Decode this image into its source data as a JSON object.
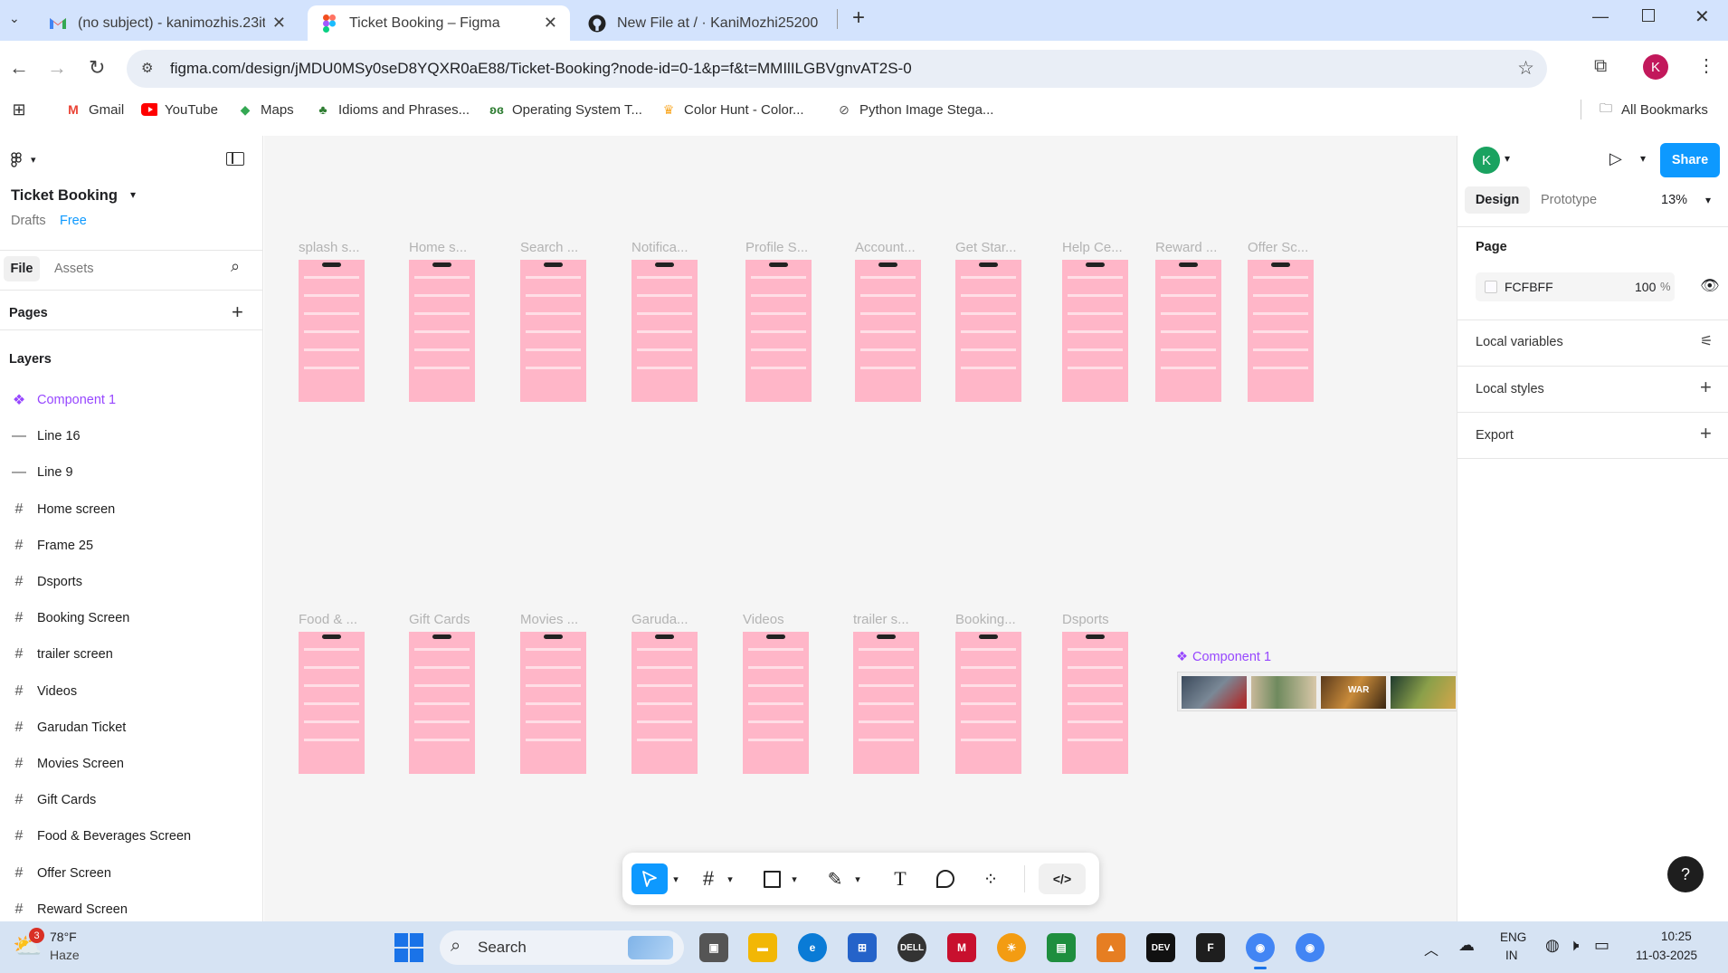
{
  "browser": {
    "tabs": [
      {
        "title": "(no subject) - kanimozhis.23it@",
        "icon": "gmail-icon"
      },
      {
        "title": "Ticket Booking – Figma",
        "icon": "figma-icon"
      },
      {
        "title": "New File at / · KaniMozhi25200",
        "icon": "github-icon"
      }
    ],
    "url": "figma.com/design/jMDU0MSy0seD8YQXR0aE88/Ticket-Booking?node-id=0-1&p=f&t=MMIlILGBVgnvAT2S-0",
    "profile_initial": "K",
    "bookmarks": [
      "Gmail",
      "YouTube",
      "Maps",
      "Idioms and Phrases...",
      "Operating System T...",
      "Color Hunt - Color...",
      "Python Image Stega..."
    ],
    "all_bookmarks": "All Bookmarks"
  },
  "figma": {
    "file_name": "Ticket Booking",
    "drafts": "Drafts",
    "plan": "Free",
    "tabs": {
      "file": "File",
      "assets": "Assets"
    },
    "pages_label": "Pages",
    "layers_label": "Layers",
    "layers": [
      {
        "name": "Component 1",
        "type": "component"
      },
      {
        "name": "Line 16",
        "type": "line"
      },
      {
        "name": "Line 9",
        "type": "line"
      },
      {
        "name": "Home screen",
        "type": "frame"
      },
      {
        "name": "Frame 25",
        "type": "frame"
      },
      {
        "name": "Dsports",
        "type": "frame"
      },
      {
        "name": "Booking Screen",
        "type": "frame"
      },
      {
        "name": "trailer screen",
        "type": "frame"
      },
      {
        "name": "Videos",
        "type": "frame"
      },
      {
        "name": "Garudan  Ticket",
        "type": "frame"
      },
      {
        "name": "Movies Screen",
        "type": "frame"
      },
      {
        "name": "Gift Cards",
        "type": "frame"
      },
      {
        "name": "Food & Beverages Screen",
        "type": "frame"
      },
      {
        "name": "Offer Screen",
        "type": "frame"
      },
      {
        "name": "Reward Screen",
        "type": "frame"
      }
    ],
    "canvas_frames_row1": [
      "splash s...",
      "Home s...",
      "Search ...",
      "Notifica...",
      "Profile S...",
      "Account...",
      "Get Star...",
      "Help Ce...",
      "Reward ...",
      "Offer Sc..."
    ],
    "canvas_frames_row2": [
      "Food & ...",
      "Gift Cards",
      "Movies ...",
      "Garuda...",
      "Videos",
      "trailer s...",
      "Booking...",
      "Dsports"
    ],
    "component_label": "Component 1",
    "right": {
      "user_initial": "K",
      "share": "Share",
      "design_tab": "Design",
      "prototype_tab": "Prototype",
      "zoom": "13%",
      "page_label": "Page",
      "page_color": "FCFBFF",
      "page_opacity": "100",
      "percent": "%",
      "local_variables": "Local variables",
      "local_styles": "Local styles",
      "export": "Export",
      "help": "?"
    }
  },
  "taskbar": {
    "weather_temp": "78°F",
    "weather_desc": "Haze",
    "weather_badge": "3",
    "search": "Search",
    "lang1": "ENG",
    "lang2": "IN",
    "time": "10:25",
    "date": "11-03-2025"
  }
}
